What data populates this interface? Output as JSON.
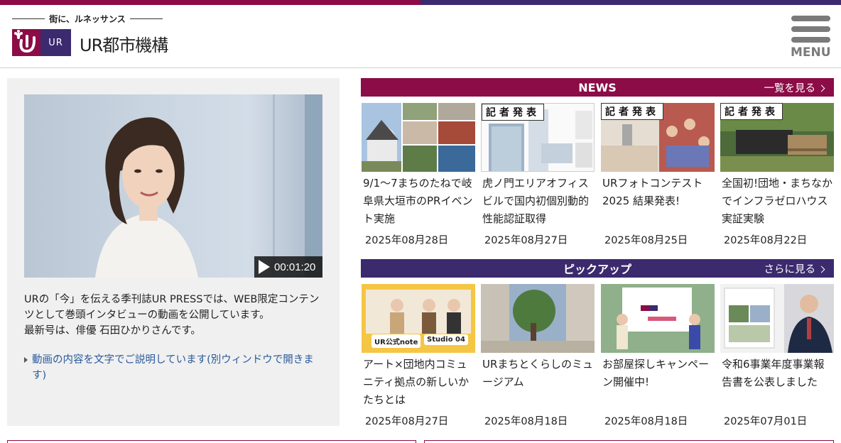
{
  "colors": {
    "brand_primary": "#8b0c46",
    "brand_secondary": "#3b2a6e",
    "feature_bg": "#f0f0f0",
    "link": "#2a5a9a"
  },
  "header": {
    "tagline": "街に、ルネッサンス",
    "logo_mark_text": "UR",
    "org_name": "UR都市機構",
    "menu_label": "MENU"
  },
  "feature": {
    "video_duration": "00:01:20",
    "description": "URの「今」を伝える季刊誌UR PRESSでは、WEB限定コンテンツとして巻頭インタビューの動画を公開しています。\n最新号は、俳優 石田ひかりさんです。",
    "link_text": "動画の内容を文字でご説明しています(別ウィンドウで開きます)"
  },
  "news": {
    "title": "NEWS",
    "more_label": "一覧を見る",
    "items": [
      {
        "title": "9/1〜7まちのたねで岐阜県大垣市のPRイベント実施",
        "date": "2025年08月28日",
        "icon": "collage-photo"
      },
      {
        "title": "虎ノ門エリアオフィスビルで国内初個別動的性能認証取得",
        "date": "2025年08月27日",
        "badge": "記者発表",
        "icon": "building-photo"
      },
      {
        "title": "URフォトコンテスト2025 結果発表!",
        "date": "2025年08月25日",
        "badge": "記者発表",
        "icon": "event-photo"
      },
      {
        "title": "全国初!団地・まちなかでインフラゼロハウス実証実験",
        "date": "2025年08月22日",
        "badge": "記者発表",
        "icon": "house-photo"
      }
    ]
  },
  "pickup": {
    "title": "ピックアップ",
    "more_label": "さらに見る",
    "items": [
      {
        "title": "アート×団地内コミュニティ拠点の新しいかたちとは",
        "date": "2025年08月27日",
        "thumb_text_1": "UR公式note",
        "thumb_text_2": "Studio 04",
        "icon": "studio-photo"
      },
      {
        "title": "URまちとくらしのミュージアム",
        "date": "2025年08月18日",
        "icon": "museum-photo"
      },
      {
        "title": "お部屋探しキャンペーン開催中!",
        "date": "2025年08月18日",
        "icon": "campaign-photo"
      },
      {
        "title": "令和6事業年度事業報告書を公表しました",
        "date": "2025年07月01日",
        "icon": "report-photo"
      }
    ]
  }
}
